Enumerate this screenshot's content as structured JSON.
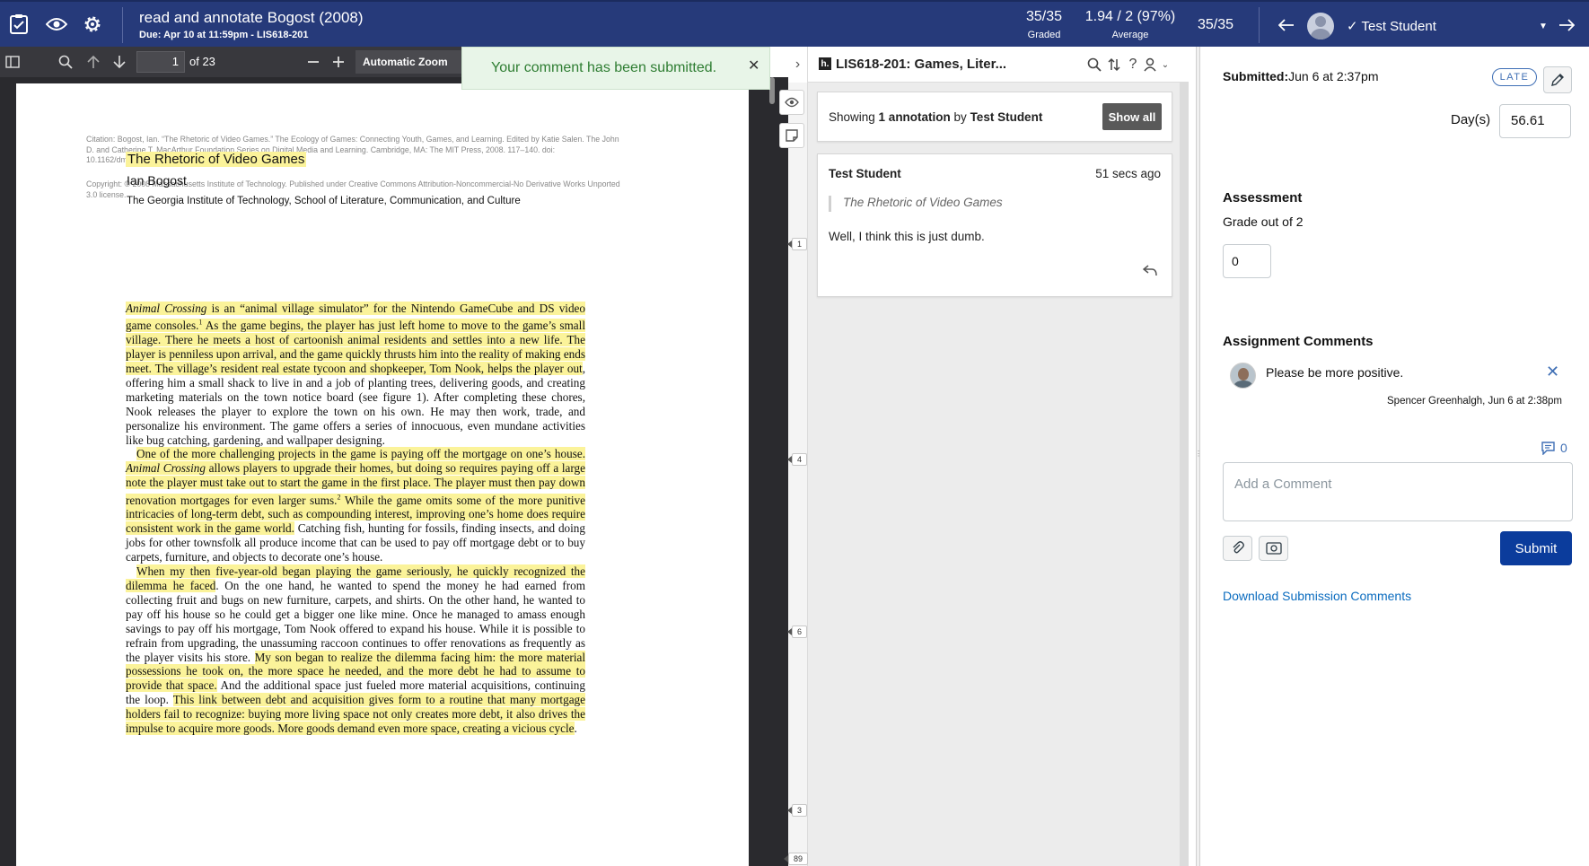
{
  "header": {
    "title": "read and annotate Bogost (2008)",
    "due": "Due: Apr 10 at 11:59pm - LIS618-201",
    "graded_value": "35/35",
    "graded_label": "Graded",
    "average_value": "1.94 / 2 (97%)",
    "average_label": "Average",
    "student_position": "35/35",
    "student_name": "Test Student"
  },
  "pdf": {
    "page_number": "1",
    "page_total": "of 23",
    "zoom": "Automatic Zoom",
    "citation": "Citation: Bogost, Ian. “The Rhetoric of Video Games.” The Ecology of Games: Connecting Youth, Games, and Learning. Edited by Katie Salen. The John D. and Catherine T. MacArthur Foundation Series on Digital Media and Learning. Cambridge, MA: The MIT Press, 2008. 117–140. doi: 10.1162/dmal.9780262693646.117",
    "copyright": "Copyright: © 2008 Massachusetts Institute of Technology. Published under Creative Commons Attribution-Noncommercial-No Derivative Works Unported 3.0 license.",
    "article_title": "The Rhetoric of Video Games",
    "author": "Ian Bogost",
    "institution": "The Georgia Institute of Technology, School of Literature, Communication, and Culture",
    "p1": {
      "a": "Animal Crossing",
      "b": " is an “animal village simulator” for the Nintendo GameCube and DS video game consoles.",
      "c": "1",
      "d": " As the game begins, the player has just left home to move to the game’s small village. There he meets a host of cartoonish animal residents and settles into a new life. The player is penniless upon arrival, and the game quickly thrusts him into the reality of making ends meet. The village’s resident real estate tycoon and shopkeeper, Tom Nook, helps the player out",
      "e": ", offering him a small shack to live in and a job of planting trees, delivering goods, and creating marketing materials on the town notice board (see figure 1). After completing these chores, Nook releases the player to explore the town on his own. He may then work, trade, and personalize his environment. The game offers a series of innocuous, even mundane activities like bug catching, gardening, and wallpaper designing."
    },
    "p2": {
      "a": "One of the more challenging projects in the game is paying off the mortgage on one’s house. ",
      "b": "Animal Crossing",
      "c": " allows players to upgrade their homes, but doing so requires paying off a large note the player must take out to start the game in the first place. The player must then pay down renovation mortgages for even larger sums.",
      "d": "2",
      "e": " While the game omits some of the more punitive intricacies of long-term debt, such as compounding interest, improving one’s home does require consistent work in the game world.",
      "f": " Catching fish, hunting for fossils, finding insects, and doing jobs for other townsfolk all produce income that can be used to pay off mortgage debt or to buy carpets, furniture, and objects to decorate one’s house."
    },
    "p3": {
      "a": "When my then five-year-old began playing the game seriously, he quickly recognized the dilemma he faced",
      "b": ". On the one hand, he wanted to spend the money he had earned from collecting fruit and bugs on new furniture, carpets, and shirts. On the other hand, he wanted to pay off his house so he could get a bigger one like mine. Once he managed to amass enough savings to pay off his mortgage, Tom Nook offered to expand his house. While it is possible to refrain from upgrading, the unassuming raccoon continues to offer renovations as frequently as the player visits his store. ",
      "c": "My son began to realize the dilemma facing him: the more material possessions he took on, the more space he needed, and the more debt he had to assume to provide that space.",
      "d": " And the additional space just fueled more material acquisitions, continuing the loop. ",
      "e": "This link between debt and acquisition gives form to a routine that many mortgage holders fail to recognize: buying more living space not only creates more debt, it also drives the impulse to acquire more goods. More goods demand even more space, creating a vicious cycle",
      "f": "."
    }
  },
  "toast": {
    "message": "Your comment has been submitted."
  },
  "hypothesis": {
    "group_title": "LIS618-201: Games, Liter...",
    "logo_letter": "h.",
    "showing_prefix": "Showing ",
    "showing_count": "1 annotation",
    "showing_by": " by ",
    "showing_user": "Test Student",
    "show_all_label": "Show all",
    "annotation": {
      "user": "Test Student",
      "time": "51 secs ago",
      "quote": "The Rhetoric of Video Games",
      "text": "Well, I think this is just dumb."
    },
    "buckets": [
      "1",
      "4",
      "6",
      "3",
      "89"
    ]
  },
  "grading": {
    "submitted_label": "Submitted:",
    "submitted_value": "Jun 6 at 2:37pm",
    "late_badge": "LATE",
    "days_label": "Day(s)",
    "days_value": "56.61",
    "assessment_heading": "Assessment",
    "grade_out_of": "Grade out of 2",
    "grade_value": "0",
    "comments_heading": "Assignment Comments",
    "comment_text": "Please be more positive.",
    "comment_meta": "Spencer Greenhalgh, Jun 6 at 2:38pm",
    "comment_count": "0",
    "comment_placeholder": "Add a Comment",
    "submit_label": "Submit",
    "download_label": "Download Submission Comments"
  },
  "colors": {
    "header_bg": "#263a7a",
    "highlight": "#fbf39a",
    "submit_bg": "#0b3c9c",
    "link": "#0b6cbf",
    "toast_text": "#2e7d32"
  },
  "icons": [
    "speedgrader-icon",
    "eye-icon",
    "gear-icon",
    "sidebar-toggle-icon",
    "search-icon",
    "arrow-up-icon",
    "arrow-down-icon",
    "minus-icon",
    "plus-icon",
    "close-icon",
    "chevron-right-icon",
    "sort-icon",
    "help-icon",
    "user-icon",
    "chevron-down-icon",
    "reply-icon",
    "pencil-icon",
    "comment-icon",
    "paperclip-icon",
    "media-icon",
    "arrow-left-icon",
    "arrow-right-icon",
    "check-icon",
    "eye-toggle-icon",
    "page-note-icon"
  ]
}
